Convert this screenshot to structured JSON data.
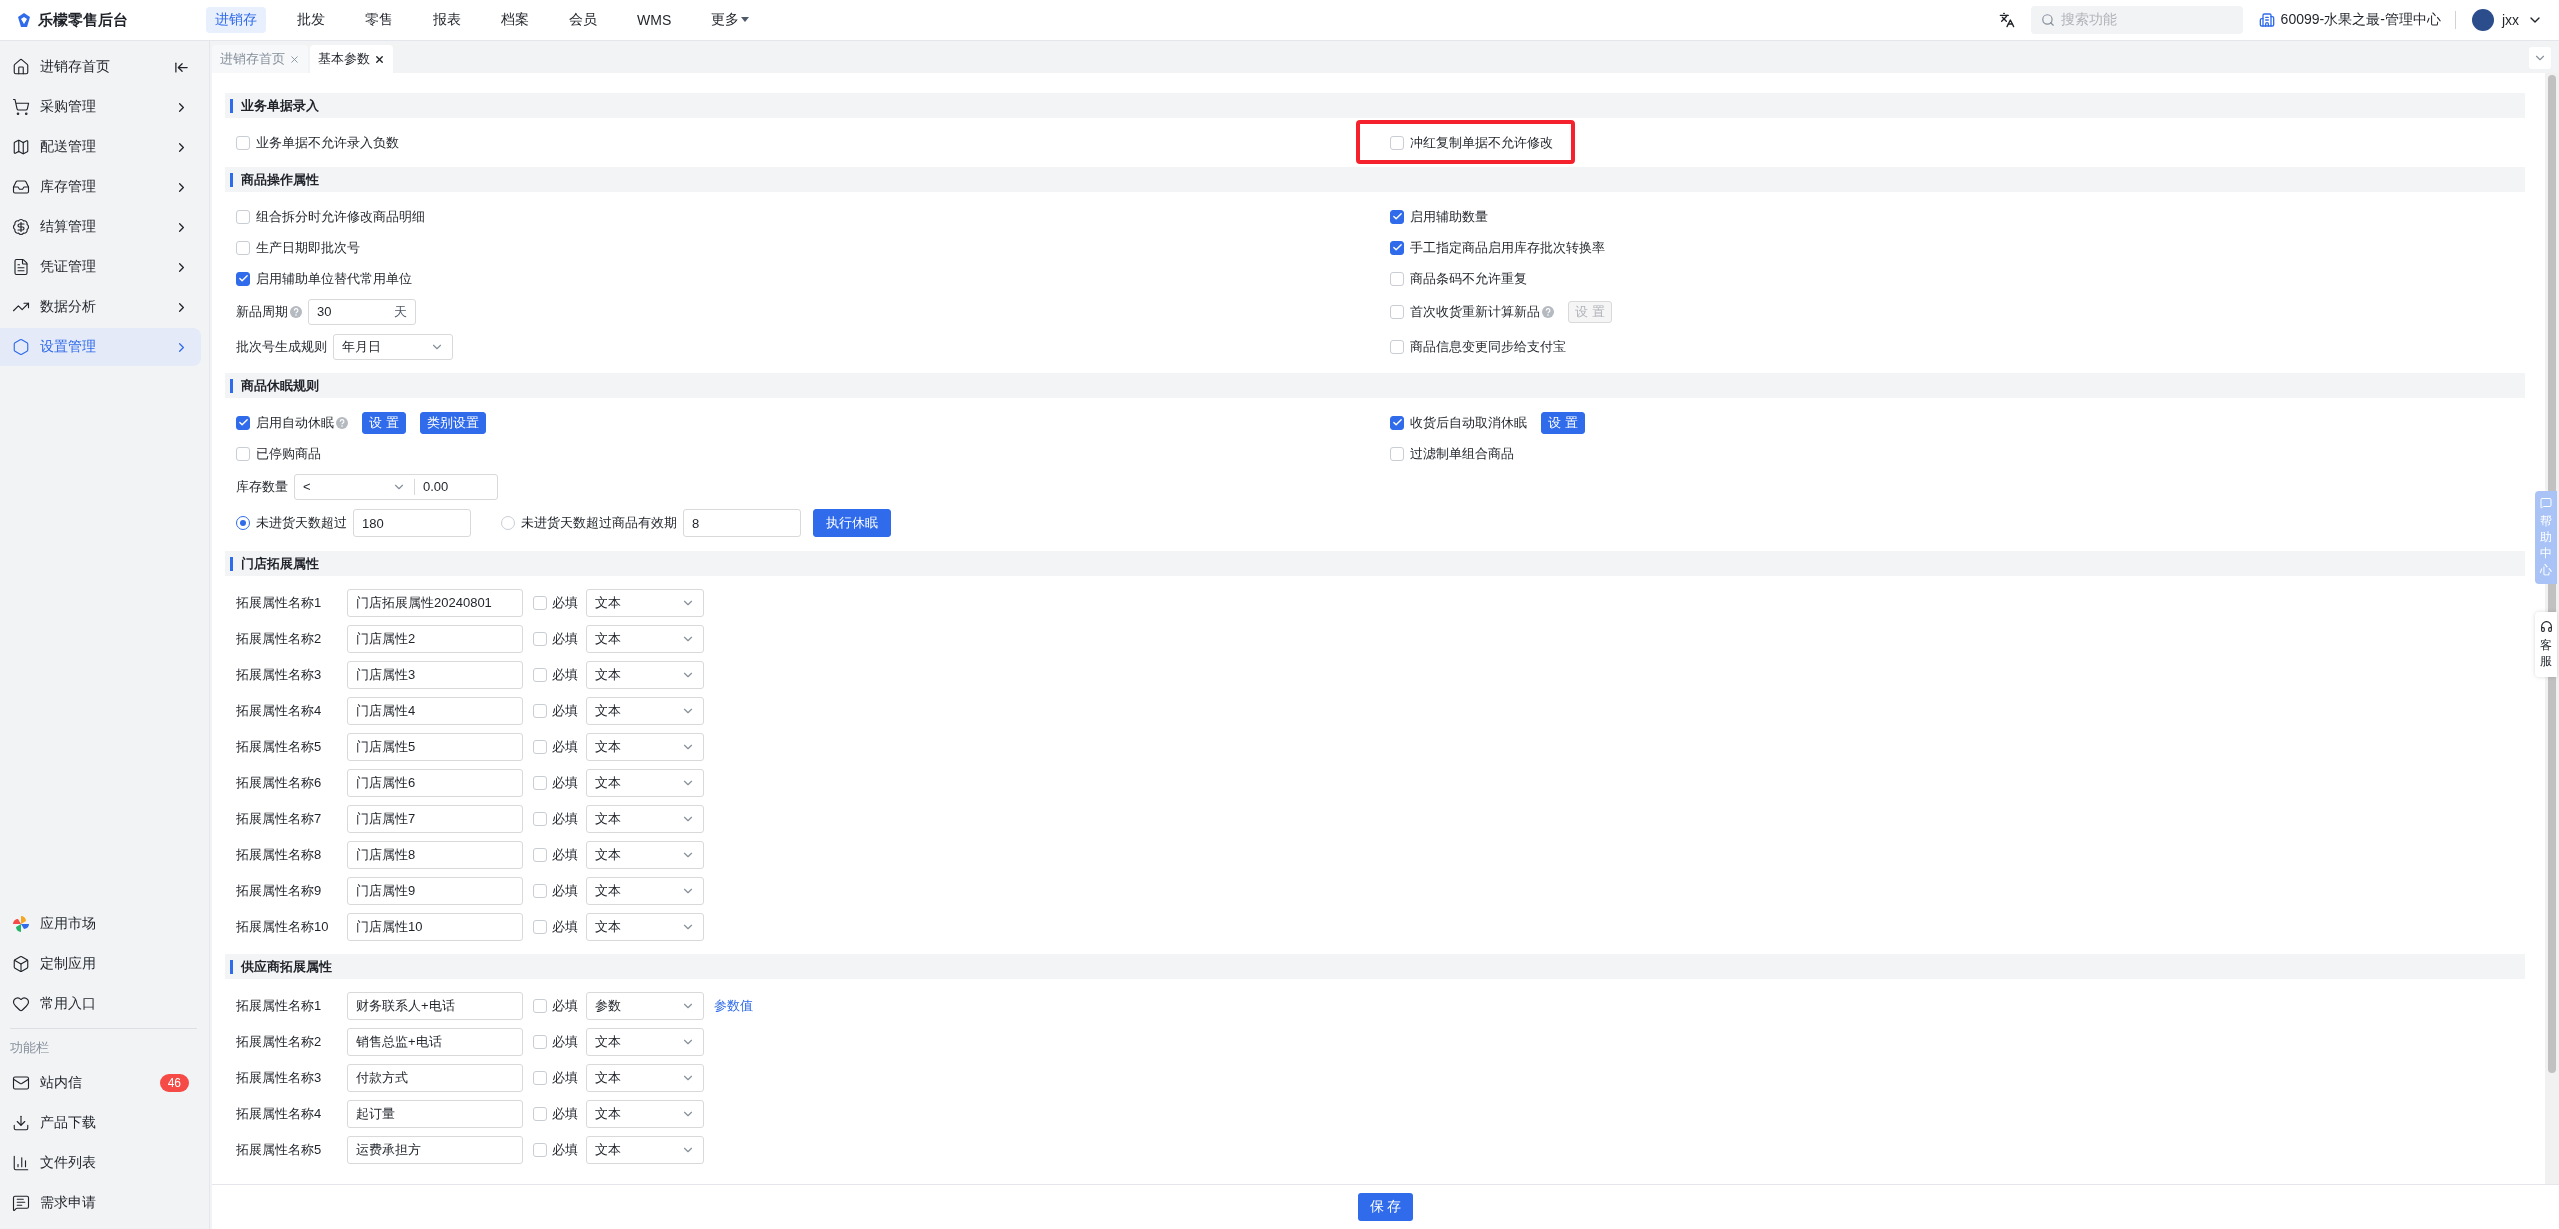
{
  "topbar": {
    "logo": "乐檬零售后台",
    "nav": [
      {
        "label": "进销存",
        "selected": true,
        "dropdown": false
      },
      {
        "label": "批发",
        "selected": false,
        "dropdown": false
      },
      {
        "label": "零售",
        "selected": false,
        "dropdown": false
      },
      {
        "label": "报表",
        "selected": false,
        "dropdown": false
      },
      {
        "label": "档案",
        "selected": false,
        "dropdown": false
      },
      {
        "label": "会员",
        "selected": false,
        "dropdown": false
      },
      {
        "label": "WMS",
        "selected": false,
        "dropdown": false
      },
      {
        "label": "更多",
        "selected": false,
        "dropdown": true
      }
    ],
    "search": {
      "placeholder": "搜索功能"
    },
    "org": "60099-水果之最-管理中心",
    "user": "jxx"
  },
  "sidebar": {
    "items": [
      {
        "label": "进销存首页",
        "selected": false,
        "kind": "collapse"
      },
      {
        "label": "采购管理",
        "selected": false,
        "kind": "submenu"
      },
      {
        "label": "配送管理",
        "selected": false,
        "kind": "submenu"
      },
      {
        "label": "库存管理",
        "selected": false,
        "kind": "submenu"
      },
      {
        "label": "结算管理",
        "selected": false,
        "kind": "submenu"
      },
      {
        "label": "凭证管理",
        "selected": false,
        "kind": "submenu"
      },
      {
        "label": "数据分析",
        "selected": false,
        "kind": "submenu"
      },
      {
        "label": "设置管理",
        "selected": true,
        "kind": "submenu"
      }
    ],
    "apps": [
      {
        "label": "应用市场"
      },
      {
        "label": "定制应用"
      },
      {
        "label": "常用入口"
      }
    ],
    "tools_title": "功能栏",
    "tools": [
      {
        "label": "站内信",
        "badge": "46"
      },
      {
        "label": "产品下载"
      },
      {
        "label": "文件列表"
      },
      {
        "label": "需求申请"
      }
    ]
  },
  "tabs": [
    {
      "label": "进销存首页",
      "selected": false
    },
    {
      "label": "基本参数",
      "selected": true
    }
  ],
  "sections": [
    {
      "title": "业务单据录入",
      "kind": "options",
      "left": [
        {
          "kind": "checkbox",
          "label": "业务单据不允许录入负数",
          "checked": false
        }
      ],
      "right": [
        {
          "kind": "checkbox",
          "label": "冲红复制单据不允许修改",
          "checked": false,
          "highlighted": true
        }
      ]
    },
    {
      "title": "商品操作属性",
      "kind": "options",
      "left": [
        {
          "kind": "checkbox",
          "label": "组合拆分时允许修改商品明细",
          "checked": false
        },
        {
          "kind": "checkbox",
          "label": "生产日期即批次号",
          "checked": false
        },
        {
          "kind": "checkbox",
          "label": "启用辅助单位替代常用单位",
          "checked": true
        },
        {
          "kind": "number",
          "label": "新品周期",
          "help": true,
          "value": "30",
          "unit": "天"
        },
        {
          "kind": "select",
          "label": "批次号生成规则",
          "value": "年月日"
        }
      ],
      "right": [
        {
          "kind": "checkbox",
          "label": "启用辅助数量",
          "checked": true
        },
        {
          "kind": "checkbox",
          "label": "手工指定商品启用库存批次转换率",
          "checked": true
        },
        {
          "kind": "checkbox",
          "label": "商品条码不允许重复",
          "checked": false
        },
        {
          "kind": "checkbox",
          "label": "首次收货重新计算新品",
          "checked": false,
          "help": true,
          "buttons": [
            {
              "label": "设 置",
              "disabled": true
            }
          ]
        },
        {
          "kind": "checkbox",
          "label": "商品信息变更同步给支付宝",
          "checked": false
        }
      ]
    },
    {
      "title": "商品休眠规则",
      "kind": "options",
      "left": [
        {
          "kind": "checkbox",
          "label": "启用自动休眠",
          "checked": true,
          "help": true,
          "buttons": [
            {
              "label": "设 置",
              "disabled": false
            },
            {
              "label": "类别设置",
              "disabled": false
            }
          ]
        },
        {
          "kind": "checkbox",
          "label": "已停购商品",
          "checked": false
        },
        {
          "kind": "compare",
          "label": "库存数量",
          "operator": "<",
          "value": "0.00"
        },
        {
          "kind": "radios",
          "options": [
            {
              "label": "未进货天数超过",
              "selected": true,
              "value": "180"
            },
            {
              "label": "未进货天数超过商品有效期",
              "selected": false,
              "value": "8"
            }
          ],
          "button": "执行休眠"
        }
      ],
      "right": [
        {
          "kind": "checkbox",
          "label": "收货后自动取消休眠",
          "checked": true,
          "buttons": [
            {
              "label": "设 置",
              "disabled": false
            }
          ]
        },
        {
          "kind": "checkbox",
          "label": "过滤制单组合商品",
          "checked": false
        }
      ]
    },
    {
      "title": "门店拓展属性",
      "kind": "fields",
      "rows": [
        {
          "label": "拓展属性名称1",
          "value": "门店拓展属性20240801",
          "required": false,
          "required_label": "必填",
          "type": "文本"
        },
        {
          "label": "拓展属性名称2",
          "value": "门店属性2",
          "required": false,
          "required_label": "必填",
          "type": "文本"
        },
        {
          "label": "拓展属性名称3",
          "value": "门店属性3",
          "required": false,
          "required_label": "必填",
          "type": "文本"
        },
        {
          "label": "拓展属性名称4",
          "value": "门店属性4",
          "required": false,
          "required_label": "必填",
          "type": "文本"
        },
        {
          "label": "拓展属性名称5",
          "value": "门店属性5",
          "required": false,
          "required_label": "必填",
          "type": "文本"
        },
        {
          "label": "拓展属性名称6",
          "value": "门店属性6",
          "required": false,
          "required_label": "必填",
          "type": "文本"
        },
        {
          "label": "拓展属性名称7",
          "value": "门店属性7",
          "required": false,
          "required_label": "必填",
          "type": "文本"
        },
        {
          "label": "拓展属性名称8",
          "value": "门店属性8",
          "required": false,
          "required_label": "必填",
          "type": "文本"
        },
        {
          "label": "拓展属性名称9",
          "value": "门店属性9",
          "required": false,
          "required_label": "必填",
          "type": "文本"
        },
        {
          "label": "拓展属性名称10",
          "value": "门店属性10",
          "required": false,
          "required_label": "必填",
          "type": "文本"
        }
      ]
    },
    {
      "title": "供应商拓展属性",
      "kind": "fields",
      "rows": [
        {
          "label": "拓展属性名称1",
          "value": "财务联系人+电话",
          "required": false,
          "required_label": "必填",
          "type": "参数",
          "link": "参数值"
        },
        {
          "label": "拓展属性名称2",
          "value": "销售总监+电话",
          "required": false,
          "required_label": "必填",
          "type": "文本"
        },
        {
          "label": "拓展属性名称3",
          "value": "付款方式",
          "required": false,
          "required_label": "必填",
          "type": "文本"
        },
        {
          "label": "拓展属性名称4",
          "value": "起订量",
          "required": false,
          "required_label": "必填",
          "type": "文本"
        },
        {
          "label": "拓展属性名称5",
          "value": "运费承担方",
          "required": false,
          "required_label": "必填",
          "type": "文本"
        }
      ]
    }
  ],
  "footer": {
    "save": "保 存"
  },
  "help_widget": {
    "help": "帮助中心",
    "service": "客服"
  }
}
